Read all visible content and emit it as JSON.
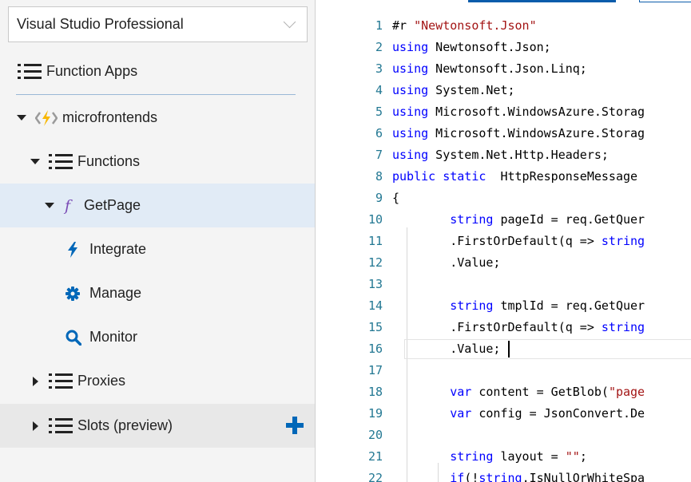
{
  "subscription": {
    "selected": "Visual Studio Professional"
  },
  "tree": {
    "function_apps": "Function Apps",
    "app_name": "microfrontends",
    "functions": "Functions",
    "function_name": "GetPage",
    "integrate": "Integrate",
    "manage": "Manage",
    "monitor": "Monitor",
    "proxies": "Proxies",
    "slots": "Slots (preview)"
  },
  "editor": {
    "line_numbers": [
      "1",
      "2",
      "3",
      "4",
      "5",
      "6",
      "7",
      "8",
      "9",
      "10",
      "11",
      "12",
      "13",
      "14",
      "15",
      "16",
      "17",
      "18",
      "19",
      "20",
      "21",
      "22"
    ]
  },
  "colors": {
    "accent": "#0067b8",
    "selected_row": "#e1ebf6",
    "keyword": "#0000ff",
    "string": "#a31515",
    "line_number": "#237893"
  }
}
